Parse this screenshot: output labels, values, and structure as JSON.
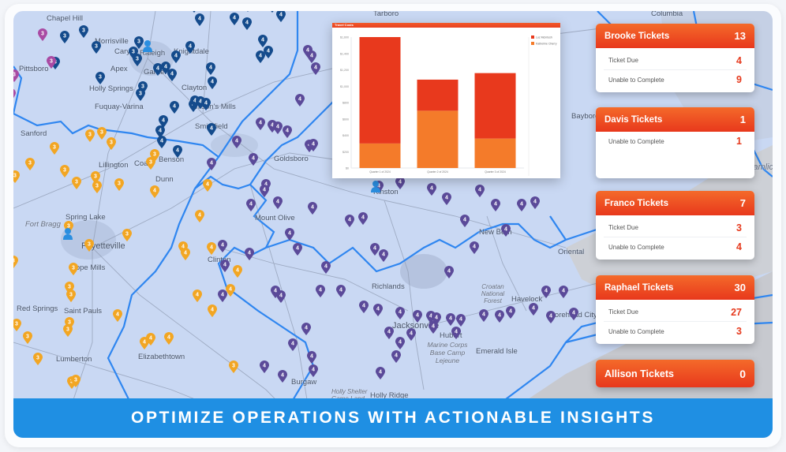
{
  "banner": {
    "title": "OPTIMIZE OPERATIONS WITH ACTIONABLE INSIGHTS",
    "color": "#1f8fe3"
  },
  "map": {
    "towns": [
      {
        "name": "Chapel Hill"
      },
      {
        "name": "Morrisville"
      },
      {
        "name": "Cary"
      },
      {
        "name": "Raleigh"
      },
      {
        "name": "Knightdale"
      },
      {
        "name": "Pittsboro"
      },
      {
        "name": "Apex"
      },
      {
        "name": "Garner"
      },
      {
        "name": "Clayton"
      },
      {
        "name": "Holly Springs"
      },
      {
        "name": "Fuquay-Varina"
      },
      {
        "name": "Wilson's Mills"
      },
      {
        "name": "Smithfield"
      },
      {
        "name": "Sanford"
      },
      {
        "name": "Lillington"
      },
      {
        "name": "Coats"
      },
      {
        "name": "Benson"
      },
      {
        "name": "Dunn"
      },
      {
        "name": "Spring Lake"
      },
      {
        "name": "Fort Bragg"
      },
      {
        "name": "Fayetteville"
      },
      {
        "name": "Hope Mills"
      },
      {
        "name": "Clinton"
      },
      {
        "name": "Red Springs"
      },
      {
        "name": "Saint Pauls"
      },
      {
        "name": "Lumberton"
      },
      {
        "name": "Elizabethtown"
      },
      {
        "name": "Goldsboro"
      },
      {
        "name": "Mount Olive"
      },
      {
        "name": "Kinston"
      },
      {
        "name": "New Bern"
      },
      {
        "name": "Oriental"
      },
      {
        "name": "Richlands"
      },
      {
        "name": "Jacksonville"
      },
      {
        "name": "Hubert"
      },
      {
        "name": "Marine Corps Base Camp Lejeune"
      },
      {
        "name": "Croatan National Forest"
      },
      {
        "name": "Havelock"
      },
      {
        "name": "Morehead City"
      },
      {
        "name": "Emerald Isle"
      },
      {
        "name": "Burgaw"
      },
      {
        "name": "Holly Shelter Game Land"
      },
      {
        "name": "Holly Ridge"
      },
      {
        "name": "Tarboro"
      },
      {
        "name": "Columbia"
      },
      {
        "name": "Bayboro"
      },
      {
        "name": "Pamlico Sound"
      }
    ],
    "marker_colors": {
      "group_3_orange": "#f2a623",
      "group_3_magenta": "#a94aa3",
      "group_3_navy": "#144b8c",
      "group_4_navy": "#144b8c",
      "group_4_purple": "#5b4a99",
      "group_4_orange": "#f2a623",
      "person": "#2a8ee0"
    }
  },
  "chart_data": {
    "type": "bar",
    "stacked": true,
    "title": "Travel Costs",
    "categories": [
      "Quarter 1 of 2024",
      "Quarter 2 of 2024",
      "Quarter 3 of 2024"
    ],
    "series": [
      {
        "name": "Luz McIntosh",
        "color": "#e8391d",
        "values": [
          1300,
          380,
          800
        ]
      },
      {
        "name": "Katherine Cherry",
        "color": "#f47b2a",
        "values": [
          300,
          700,
          360
        ]
      }
    ],
    "yticks": [
      "$0",
      "$200",
      "$400",
      "$600",
      "$800",
      "$1,000",
      "$1,200",
      "$1,400",
      "$1,600"
    ],
    "ylim": [
      0,
      1600
    ],
    "xlabel": "",
    "ylabel": "",
    "legend": "top-right",
    "grid": false
  },
  "tickets": [
    {
      "name": "Brooke Tickets",
      "total": "13",
      "rows": [
        {
          "label": "Ticket Due",
          "value": "4"
        },
        {
          "label": "Unable to Complete",
          "value": "9"
        }
      ]
    },
    {
      "name": "Davis Tickets",
      "total": "1",
      "rows": [
        {
          "label": "Unable to Complete",
          "value": "1"
        }
      ]
    },
    {
      "name": "Franco Tickets",
      "total": "7",
      "rows": [
        {
          "label": "Ticket Due",
          "value": "3"
        },
        {
          "label": "Unable to Complete",
          "value": "4"
        }
      ]
    },
    {
      "name": "Raphael Tickets",
      "total": "30",
      "rows": [
        {
          "label": "Ticket Due",
          "value": "27"
        },
        {
          "label": "Unable to Complete",
          "value": "3"
        }
      ]
    },
    {
      "name": "Allison Tickets",
      "total": "0",
      "rows": []
    }
  ]
}
